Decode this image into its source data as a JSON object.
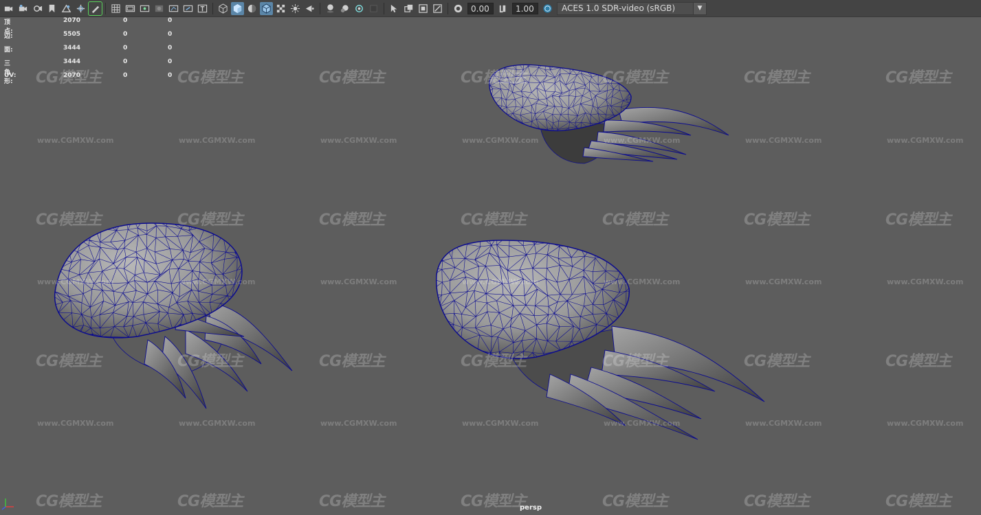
{
  "toolbar": {
    "exposure_value": "0.00",
    "gamma_value": "1.00",
    "colorspace": "ACES 1.0 SDR-video (sRGB)",
    "icons_group1": [
      "camera-select-icon",
      "camera-attributes-icon",
      "bookmark-icon",
      "image-plane-icon",
      "2d-pan-zoom-icon",
      "grease-pencil-icon"
    ],
    "icons_group2": [
      "grid-icon",
      "film-gate-icon",
      "resolution-gate-icon",
      "gate-mask-icon",
      "field-chart-icon",
      "safe-action-icon"
    ],
    "icons_group3": [
      "wireframe-icon",
      "smooth-shade-icon",
      "default-lighting-icon",
      "wireframe-on-shaded-icon",
      "textured-icon",
      "use-all-lights-icon"
    ],
    "icons_group4": [
      "shadows-icon",
      "screen-space-ao-icon",
      "motion-blur-icon",
      "anti-aliasing-icon"
    ],
    "icons_group5": [
      "isolate-select-icon",
      "xray-icon",
      "xray-joints-icon",
      "xray-components-icon"
    ]
  },
  "hud": {
    "rows": [
      {
        "label": "顶点:",
        "v1": "2070",
        "v2": "0",
        "v3": "0"
      },
      {
        "label": "边:",
        "v1": "5505",
        "v2": "0",
        "v3": "0"
      },
      {
        "label": "面:",
        "v1": "3444",
        "v2": "0",
        "v3": "0"
      },
      {
        "label": "三角形:",
        "v1": "3444",
        "v2": "0",
        "v3": "0"
      },
      {
        "label": "UV:",
        "v1": "2070",
        "v2": "0",
        "v3": "0"
      }
    ]
  },
  "watermark": {
    "logo_text": "CG模型主",
    "url_text": "www.CGMXW.com"
  },
  "viewport": {
    "camera_name": "persp",
    "wire_color": "#0b0b8f",
    "shade_color": "#9a9a9a"
  }
}
